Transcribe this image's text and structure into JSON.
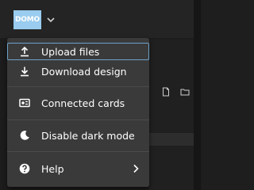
{
  "header": {
    "logo_text": "DOMO",
    "logo_color": "#99ccee",
    "logo_menu_icon": "chevron-down-icon"
  },
  "menu": {
    "items": [
      {
        "label": "Upload files",
        "icon": "upload-icon",
        "focused": true
      },
      {
        "label": "Download design",
        "icon": "download-icon"
      },
      {
        "label": "Connected cards",
        "icon": "connected-cards-icon"
      },
      {
        "label": "Disable dark mode",
        "icon": "moon-icon"
      },
      {
        "label": "Help",
        "icon": "help-icon",
        "submenu_icon": "chevron-right-icon"
      }
    ],
    "accent_color": "#6ea2c8",
    "background_color": "#3a3a3a"
  },
  "background": {
    "toolbar_icons": [
      "file-icon",
      "folder-icon"
    ]
  }
}
